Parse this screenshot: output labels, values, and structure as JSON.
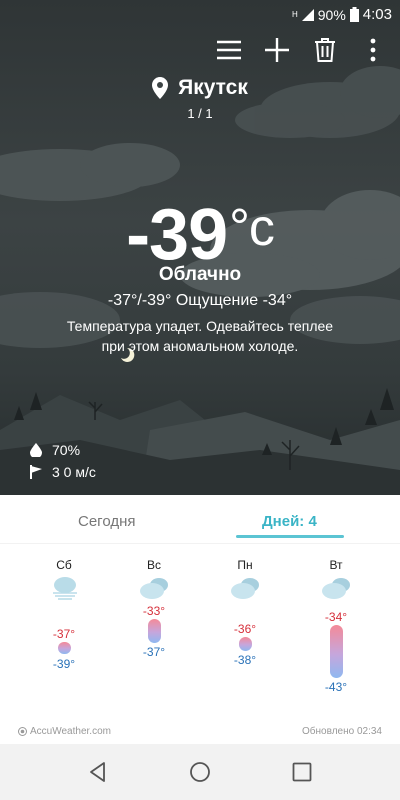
{
  "status": {
    "battery": "90%",
    "time": "4:03",
    "network": "H"
  },
  "toolbar": {
    "menu": "menu-icon",
    "add": "add-icon",
    "delete": "trash-icon",
    "more": "more-icon"
  },
  "location": {
    "city": "Якутск",
    "page": "1 / 1"
  },
  "current": {
    "temp": "-39",
    "unit": "°c",
    "condition": "Облачно",
    "range": "-37°/-39° Ощущение -34°",
    "advice": "Температура упадет. Одевайтесь теплее при этом аномальном холоде.",
    "humidity": "70%",
    "wind": "3 0 м/с"
  },
  "tabs": {
    "today": "Сегодня",
    "days": "Дней: 4"
  },
  "forecast": [
    {
      "day": "Сб",
      "icon": "fog-icon",
      "hi": "-37°",
      "lo": "-39°"
    },
    {
      "day": "Вс",
      "icon": "cloudy-icon",
      "hi": "-33°",
      "lo": "-37°"
    },
    {
      "day": "Пн",
      "icon": "cloudy-icon",
      "hi": "-36°",
      "lo": "-38°"
    },
    {
      "day": "Вт",
      "icon": "cloudy-icon",
      "hi": "-34°",
      "lo": "-43°"
    }
  ],
  "footer": {
    "brand": "AccuWeather.com",
    "updated": "Обновлено 02:34"
  },
  "colors": {
    "accent": "#3ab4c6",
    "high": "#d6303b",
    "low": "#2a72b8"
  }
}
